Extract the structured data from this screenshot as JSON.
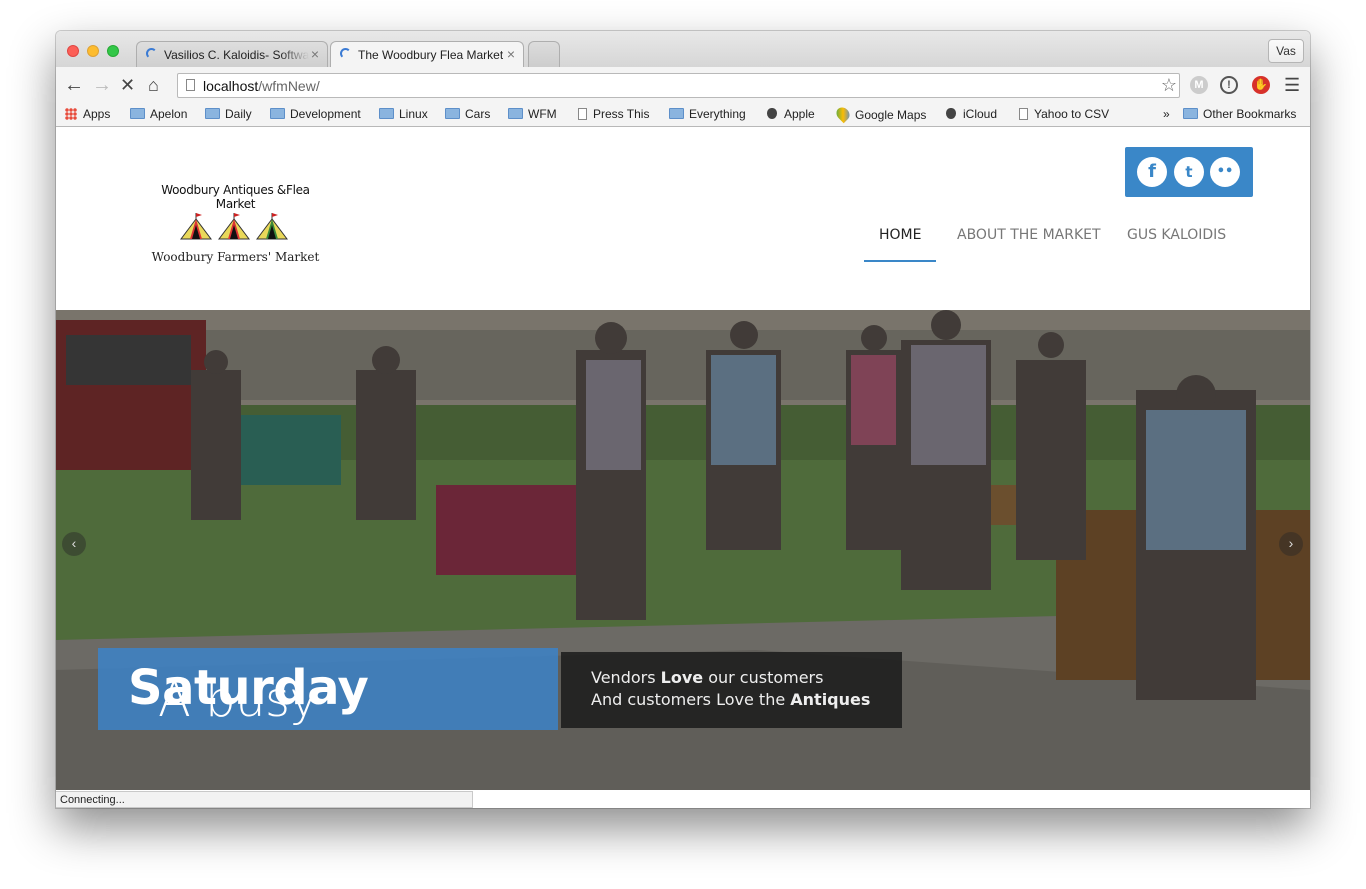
{
  "browser": {
    "tabs": [
      {
        "title": "Vasilios C. Kaloidis- Software"
      },
      {
        "title": "The Woodbury Flea Market"
      }
    ],
    "profile": "Vas",
    "url_host": "localhost",
    "url_path": "/wfmNew/",
    "bookmarks": [
      "Apps",
      "Apelon",
      "Daily",
      "Development",
      "Linux",
      "Cars",
      "WFM",
      "Press This",
      "Everything",
      "Apple",
      "Google Maps",
      "iCloud",
      "Yahoo to CSV"
    ],
    "bookmarks_overflow": "»",
    "other_bookmarks": "Other Bookmarks",
    "status": "Connecting..."
  },
  "site": {
    "logo": {
      "line1": "Woodbury Antiques &Flea Market",
      "line2": "Woodbury Farmers' Market"
    },
    "nav": [
      "HOME",
      "ABOUT THE MARKET",
      "GUS KALOIDIS"
    ],
    "active_nav": "HOME",
    "social": [
      "f",
      "t",
      "••"
    ],
    "accent": "#3a87c8",
    "hero": {
      "caption_light": "A busy ",
      "caption_bold": "Saturday",
      "sub1_a": "Vendors ",
      "sub1_b": "Love",
      "sub1_c": " our customers",
      "sub2_a": "And customers Love the ",
      "sub2_b": "Antiques",
      "prev": "‹",
      "next": "›"
    }
  }
}
